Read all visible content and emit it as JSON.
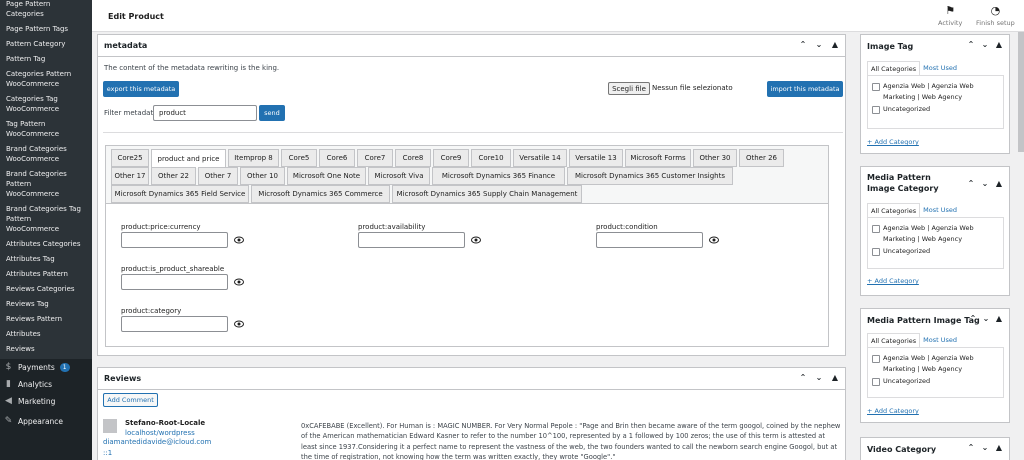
{
  "sidebar": {
    "items": [
      "Page Pattern Categories",
      "Page Pattern Tags",
      "Pattern Category",
      "Pattern Tag",
      "Categories Pattern WooCommerce",
      "Categories Tag WooCommerce",
      "Tag Pattern WooCommerce",
      "Brand Categories WooCommerce",
      "Brand Categories Pattern WooCommerce",
      "Brand Categories Tag Pattern WooCommerce",
      "Attributes Categories",
      "Attributes Tag",
      "Attributes Pattern",
      "Reviews Categories",
      "Reviews Tag",
      "Reviews Pattern",
      "Attributes",
      "Reviews"
    ],
    "main": {
      "payments": "Payments",
      "payments_badge": "1",
      "analytics": "Analytics",
      "marketing": "Marketing",
      "appearance": "Appearance"
    }
  },
  "topbar": {
    "title": "Edit Product",
    "activity": "Activity",
    "finish_setup": "Finish setup"
  },
  "metadata": {
    "title": "metadata",
    "description": "The content of the metadata rewriting is the king.",
    "export_button": "export this metadata",
    "import_button": "import this metadata",
    "file_button": "Scegli file",
    "file_status": "Nessun file selezionato",
    "filter_label": "Filter metadata",
    "filter_value": "product",
    "send_button": "send",
    "tabs_row1": [
      "Core25",
      "product and price",
      "Itemprop 8",
      "Core5",
      "Core6",
      "Core7",
      "Core8",
      "Core9",
      "Core10",
      "Versatile 14",
      "Versatile 13",
      "Microsoft Forms",
      "Other 30",
      "Other 26"
    ],
    "tabs_row2": [
      "Other 17",
      "Other 22",
      "Other 7",
      "Other 10",
      "Microsoft One Note",
      "Microsoft Viva",
      "Microsoft Dynamics 365 Finance",
      "Microsoft Dynamics 365 Customer Insights"
    ],
    "tabs_row3": [
      "Microsoft Dynamics 365 Field Service",
      "Microsoft Dynamics 365 Commerce",
      "Microsoft Dynamics 365 Supply Chain Management"
    ],
    "fields": [
      "product:price:currency",
      "product:availability",
      "product:condition",
      "product:is_product_shareable",
      "product:category"
    ]
  },
  "reviews": {
    "title": "Reviews",
    "add_comment": "Add Comment",
    "author": "Stefano-Root-Locale",
    "author_url": "localhost/wordpress",
    "author_email": "diamantedidavide@icloud.com",
    "author_ip": "::1",
    "comment": "0xCAFEBABE (Excellent). For Human is : MAGIC NUMBER. For Very Normal Pepole : \"Page and Brin then became aware of the term googol, coined by the nephew of the American mathematician Edward Kasner to refer to the number 10^100, represented by a 1 followed by 100 zeros; the use of this term is attested at least since 1937.Considering it a perfect name to represent the vastness of the web, the two founders wanted to call the newborn search engine Googol, but at the time of registration, not knowing how the term was written exactly, they wrote \"Google\".\""
  },
  "side_boxes": {
    "all_categories": "All Categories",
    "most_used": "Most Used",
    "add_category": "+ Add Category",
    "agency": "Agenzia Web | Agenzia Web Marketing | Web Agency",
    "uncategorized": "Uncategorized",
    "image_tag": "Image Tag",
    "media_pattern_image_category": "Media Pattern Image Category",
    "media_pattern_image_tag": "Media Pattern Image Tag",
    "video_category": "Video Category"
  },
  "colors": {
    "accent": "#2271b1",
    "sidebar": "#1d2327"
  },
  "icons": {
    "eye": "eye-icon",
    "flag": "flag-icon",
    "progress": "progress-circle-icon"
  }
}
